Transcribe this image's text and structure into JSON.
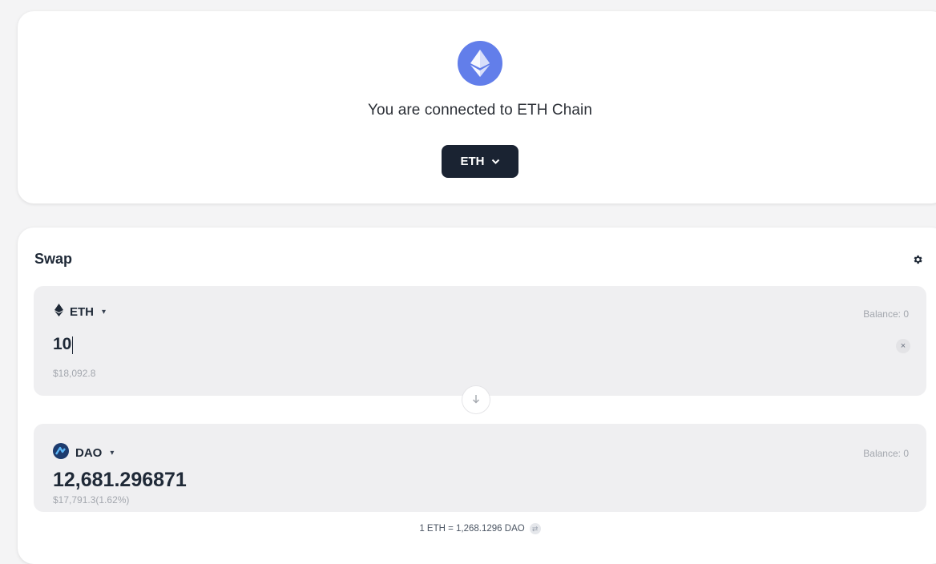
{
  "connection": {
    "message": "You are connected to ETH Chain",
    "chain_label": "ETH",
    "chain_icon": "ethereum-logo",
    "chain_color": "#627eea"
  },
  "swap": {
    "title": "Swap",
    "settings_icon": "gear-icon",
    "from": {
      "token": "ETH",
      "token_icon": "ethereum-icon",
      "balance": "Balance: 0",
      "amount": "10",
      "usd": "$18,092.8"
    },
    "switch_icon": "arrow-down-icon",
    "to": {
      "token": "DAO",
      "token_icon": "dao-token-icon",
      "balance": "Balance: 0",
      "amount": "12,681.296871",
      "usd": "$17,791.3(1.62%)"
    },
    "rate": "1 ETH = 1,268.1296 DAO"
  },
  "colors": {
    "select_bg": "#1a2332",
    "panel_bg": "#efeff1",
    "muted_text": "#a3a7ae"
  }
}
